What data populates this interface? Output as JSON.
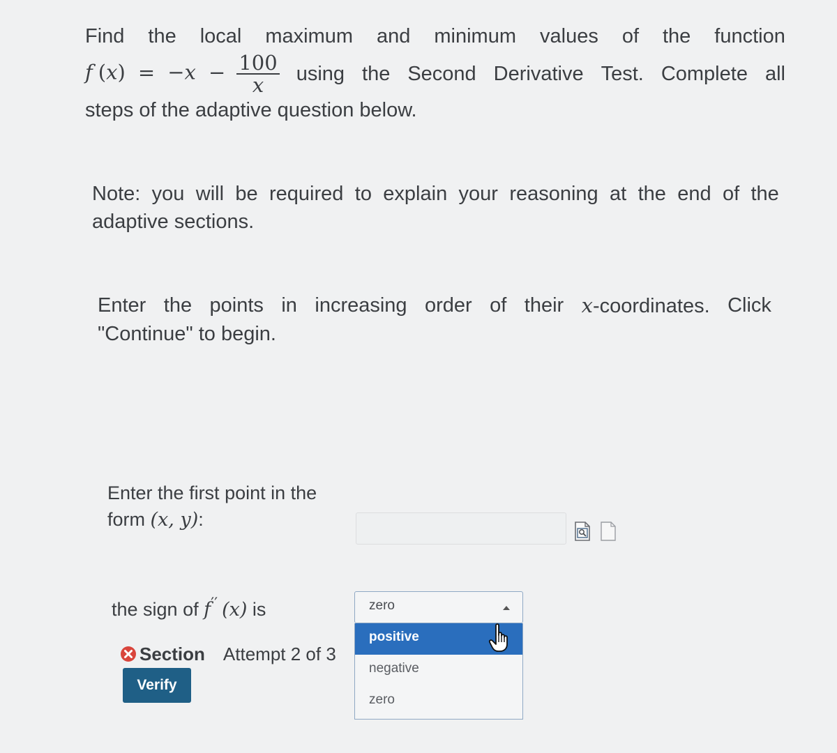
{
  "intro": {
    "line1_words": [
      "Find",
      "the",
      "local",
      "maximum",
      "and",
      "minimum",
      "values",
      "of",
      "the",
      "function"
    ],
    "f_name": "f",
    "f_var": "x",
    "f_open": "(",
    "f_close": ")",
    "equals": "=",
    "neg_x": "−x",
    "minus": "−",
    "fraction_numerator": "100",
    "fraction_denominator": "x",
    "line2_words": [
      "using",
      "the",
      "Second",
      "Derivative",
      "Test.",
      "Complete",
      "all"
    ],
    "line3": "steps of the adaptive question below."
  },
  "note": {
    "line1_words": [
      "Note:",
      "you",
      "will",
      "be",
      "required",
      "to",
      "explain",
      "your",
      "reasoning",
      "at",
      "the",
      "end",
      "of",
      "the"
    ],
    "line2": "adaptive sections."
  },
  "instructions": {
    "line1_words": [
      "Enter",
      "the",
      "points",
      "in",
      "increasing",
      "order",
      "of",
      "their"
    ],
    "coord_var": "x",
    "coord_suffix": "-coordinates.",
    "click_word": "Click",
    "line2": "\"Continue\" to begin."
  },
  "point_prompt": {
    "line1": "Enter the first point in the",
    "line2_prefix": "form ",
    "form_math": "(x, y)",
    "line2_suffix": ":",
    "input_value": ""
  },
  "icons": {
    "preview": "preview-document-icon",
    "sheet": "blank-sheet-icon",
    "error": "x-circle-icon",
    "cursor": "hand-pointer-icon"
  },
  "sign_question": {
    "prefix": "the sign of ",
    "f_name": "f",
    "primes": "′′",
    "arg": "(x)",
    "suffix": " is"
  },
  "dropdown": {
    "selected_value": "zero",
    "options": [
      "positive",
      "negative",
      "zero"
    ],
    "highlighted_option": "positive"
  },
  "section": {
    "title": "Section",
    "attempt": "Attempt 2 of 3"
  },
  "verify_button": {
    "label": "Verify"
  },
  "colors": {
    "background": "#f0f1f2",
    "text": "#3b3e42",
    "primary_button": "#1f5f86",
    "highlight": "#2a6ebd",
    "error": "#d9453c"
  }
}
